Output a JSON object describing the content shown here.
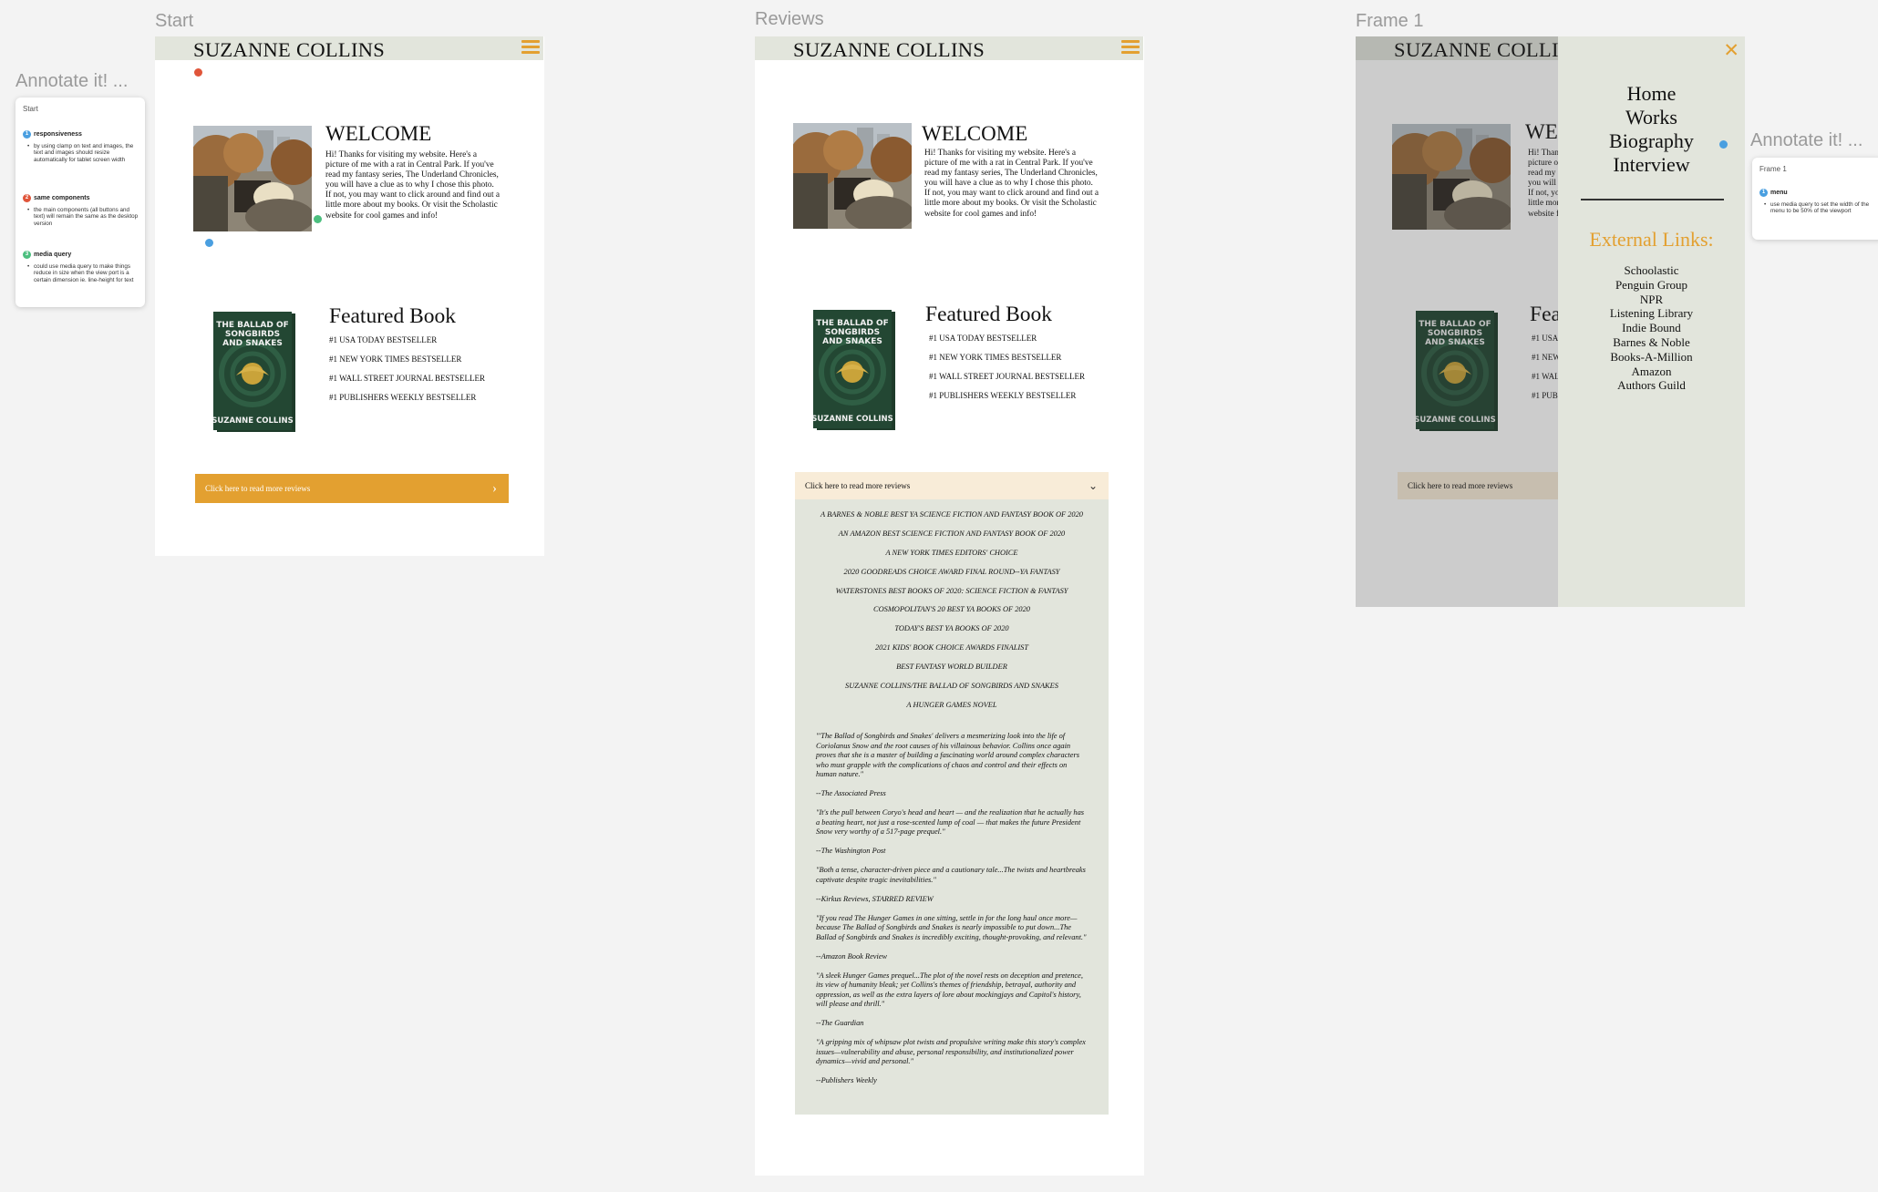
{
  "canvas": {
    "labels": {
      "start": "Start",
      "reviews": "Reviews",
      "frame1": "Frame 1",
      "annotate_left": "Annotate it! ...",
      "annotate_right": "Annotate it! ..."
    }
  },
  "site": {
    "logo": "SUZANNE COLLINS",
    "welcome_title": "WELCOME",
    "welcome_text": "Hi! Thanks for visiting my website. Here's a picture of me with a rat in Central Park. If you've read my fantasy series, The Underland Chronicles, you will have a clue as to why I chose this photo. If not, you may want to click around and find out a little more about my books. Or visit the Scholastic website for cool games and info!",
    "featured_title": "Featured Book",
    "bestsellers": [
      "#1 USA TODAY BESTSELLER",
      "#1 NEW YORK TIMES BESTSELLER",
      "#1 WALL STREET JOURNAL BESTSELLER",
      "#1 PUBLISHERS WEEKLY BESTSELLER"
    ],
    "book_cover": {
      "title_lines": [
        "THE BALLAD OF",
        "SONGBIRDS",
        "AND SNAKES"
      ],
      "author": "SUZANNE COLLINS"
    },
    "review_button": "Click here to read more reviews",
    "awards": [
      "A Barnes & Noble Best YA Science Fiction and Fantasy Book of 2020",
      "An Amazon Best Science Fiction and Fantasy Book of 2020",
      "A New York Times Editors' Choice",
      "2020 Goodreads Choice Award Final Round--YA Fantasy",
      "Waterstones Best Books of 2020: Science Fiction & Fantasy",
      "Cosmopolitan's 20 Best YA Books of 2020",
      "Today's Best YA Books of 2020",
      "2021 Kids' Book Choice Awards Finalist",
      "Best Fantasy World Builder",
      "Suzanne Collins/The Ballad of Songbirds and Snakes",
      "A Hunger Games Novel"
    ],
    "quotes": [
      {
        "text": "\"'The Ballad of Songbirds and Snakes' delivers a mesmerizing look into the life of Coriolanus Snow and the root causes of his villainous behavior. Collins once again proves that she is a master of building a fascinating world around complex characters who must grapple with the complications of chaos and control and their effects on human nature.\"",
        "source": "--The Associated Press"
      },
      {
        "text": "\"It's the pull between Coryo's head and heart — and the realization that he actually has a beating heart, not just a rose-scented lump of coal — that makes the future President Snow very worthy of a 517-page prequel.\"",
        "source": "--The Washington Post"
      },
      {
        "text": "\"Both a tense, character-driven piece and a cautionary tale...The twists and heartbreaks captivate despite tragic inevitabilities.\"",
        "source": "--Kirkus Reviews, STARRED REVIEW"
      },
      {
        "text": "\"If you read The Hunger Games in one sitting, settle in for the long haul once more—because The Ballad of Songbirds and Snakes is nearly impossible to put down...The Ballad of Songbirds and Snakes is incredibly exciting, thought-provoking, and relevant.\"",
        "source": "--Amazon Book Review"
      },
      {
        "text": "\"A sleek Hunger Games prequel...The plot of the novel rests on deception and pretence, its view of humanity bleak; yet Collins's themes of friendship, betrayal, authority and oppression, as well as the extra layers of lore about mockingjays and Capitol's history, will please and thrill.\"",
        "source": "--The Guardian"
      },
      {
        "text": "\"A gripping mix of whipsaw plot twists and propulsive writing make this story's complex issues—vulnerability and abuse, personal responsibility, and institutionalized power dynamics—vivid and personal.\"",
        "source": "--Publishers Weekly"
      }
    ],
    "menu": {
      "links": [
        "Home",
        "Works",
        "Biography",
        "Interview"
      ],
      "external_title": "External Links:",
      "external_links": [
        "Schoolastic",
        "Penguin Group",
        "NPR",
        "Listening Library",
        "Indie Bound",
        "Barnes & Noble",
        "Books-A-Million",
        "Amazon",
        "Authors Guild"
      ],
      "close_icon": "close-icon"
    }
  },
  "annotations_left": {
    "frame": "Start",
    "notes": [
      {
        "num": "1",
        "title": "responsiveness",
        "body": "by using clamp on text and images, the text and images should resize automatically for tablet screen width"
      },
      {
        "num": "2",
        "title": "same components",
        "body": "the main components (all buttons and text) will remain the same as the desktop version"
      },
      {
        "num": "3",
        "title": "media query",
        "body": "could use media query to make things reduce in size when the view port is a certain dimension ie. line-height for text"
      }
    ]
  },
  "annotations_right": {
    "frame": "Frame 1",
    "notes": [
      {
        "num": "1",
        "title": "menu",
        "body": "use media query to set the width of the menu to be 50% of the viewport"
      }
    ]
  },
  "colors": {
    "accent": "#e3a030",
    "header_bg": "#e2e5dc",
    "accordion_head": "#f8ecd8",
    "pin_blue": "#4a9fe0",
    "pin_red": "#e0553a",
    "pin_green": "#4cbf7f"
  }
}
